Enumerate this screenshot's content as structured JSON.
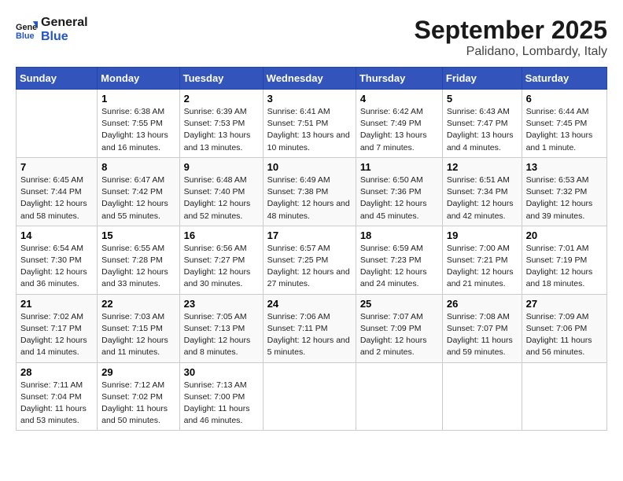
{
  "header": {
    "logo_line1": "General",
    "logo_line2": "Blue",
    "month": "September 2025",
    "location": "Palidano, Lombardy, Italy"
  },
  "weekdays": [
    "Sunday",
    "Monday",
    "Tuesday",
    "Wednesday",
    "Thursday",
    "Friday",
    "Saturday"
  ],
  "weeks": [
    [
      {
        "day": "",
        "sunrise": "",
        "sunset": "",
        "daylight": ""
      },
      {
        "day": "1",
        "sunrise": "Sunrise: 6:38 AM",
        "sunset": "Sunset: 7:55 PM",
        "daylight": "Daylight: 13 hours and 16 minutes."
      },
      {
        "day": "2",
        "sunrise": "Sunrise: 6:39 AM",
        "sunset": "Sunset: 7:53 PM",
        "daylight": "Daylight: 13 hours and 13 minutes."
      },
      {
        "day": "3",
        "sunrise": "Sunrise: 6:41 AM",
        "sunset": "Sunset: 7:51 PM",
        "daylight": "Daylight: 13 hours and 10 minutes."
      },
      {
        "day": "4",
        "sunrise": "Sunrise: 6:42 AM",
        "sunset": "Sunset: 7:49 PM",
        "daylight": "Daylight: 13 hours and 7 minutes."
      },
      {
        "day": "5",
        "sunrise": "Sunrise: 6:43 AM",
        "sunset": "Sunset: 7:47 PM",
        "daylight": "Daylight: 13 hours and 4 minutes."
      },
      {
        "day": "6",
        "sunrise": "Sunrise: 6:44 AM",
        "sunset": "Sunset: 7:45 PM",
        "daylight": "Daylight: 13 hours and 1 minute."
      }
    ],
    [
      {
        "day": "7",
        "sunrise": "Sunrise: 6:45 AM",
        "sunset": "Sunset: 7:44 PM",
        "daylight": "Daylight: 12 hours and 58 minutes."
      },
      {
        "day": "8",
        "sunrise": "Sunrise: 6:47 AM",
        "sunset": "Sunset: 7:42 PM",
        "daylight": "Daylight: 12 hours and 55 minutes."
      },
      {
        "day": "9",
        "sunrise": "Sunrise: 6:48 AM",
        "sunset": "Sunset: 7:40 PM",
        "daylight": "Daylight: 12 hours and 52 minutes."
      },
      {
        "day": "10",
        "sunrise": "Sunrise: 6:49 AM",
        "sunset": "Sunset: 7:38 PM",
        "daylight": "Daylight: 12 hours and 48 minutes."
      },
      {
        "day": "11",
        "sunrise": "Sunrise: 6:50 AM",
        "sunset": "Sunset: 7:36 PM",
        "daylight": "Daylight: 12 hours and 45 minutes."
      },
      {
        "day": "12",
        "sunrise": "Sunrise: 6:51 AM",
        "sunset": "Sunset: 7:34 PM",
        "daylight": "Daylight: 12 hours and 42 minutes."
      },
      {
        "day": "13",
        "sunrise": "Sunrise: 6:53 AM",
        "sunset": "Sunset: 7:32 PM",
        "daylight": "Daylight: 12 hours and 39 minutes."
      }
    ],
    [
      {
        "day": "14",
        "sunrise": "Sunrise: 6:54 AM",
        "sunset": "Sunset: 7:30 PM",
        "daylight": "Daylight: 12 hours and 36 minutes."
      },
      {
        "day": "15",
        "sunrise": "Sunrise: 6:55 AM",
        "sunset": "Sunset: 7:28 PM",
        "daylight": "Daylight: 12 hours and 33 minutes."
      },
      {
        "day": "16",
        "sunrise": "Sunrise: 6:56 AM",
        "sunset": "Sunset: 7:27 PM",
        "daylight": "Daylight: 12 hours and 30 minutes."
      },
      {
        "day": "17",
        "sunrise": "Sunrise: 6:57 AM",
        "sunset": "Sunset: 7:25 PM",
        "daylight": "Daylight: 12 hours and 27 minutes."
      },
      {
        "day": "18",
        "sunrise": "Sunrise: 6:59 AM",
        "sunset": "Sunset: 7:23 PM",
        "daylight": "Daylight: 12 hours and 24 minutes."
      },
      {
        "day": "19",
        "sunrise": "Sunrise: 7:00 AM",
        "sunset": "Sunset: 7:21 PM",
        "daylight": "Daylight: 12 hours and 21 minutes."
      },
      {
        "day": "20",
        "sunrise": "Sunrise: 7:01 AM",
        "sunset": "Sunset: 7:19 PM",
        "daylight": "Daylight: 12 hours and 18 minutes."
      }
    ],
    [
      {
        "day": "21",
        "sunrise": "Sunrise: 7:02 AM",
        "sunset": "Sunset: 7:17 PM",
        "daylight": "Daylight: 12 hours and 14 minutes."
      },
      {
        "day": "22",
        "sunrise": "Sunrise: 7:03 AM",
        "sunset": "Sunset: 7:15 PM",
        "daylight": "Daylight: 12 hours and 11 minutes."
      },
      {
        "day": "23",
        "sunrise": "Sunrise: 7:05 AM",
        "sunset": "Sunset: 7:13 PM",
        "daylight": "Daylight: 12 hours and 8 minutes."
      },
      {
        "day": "24",
        "sunrise": "Sunrise: 7:06 AM",
        "sunset": "Sunset: 7:11 PM",
        "daylight": "Daylight: 12 hours and 5 minutes."
      },
      {
        "day": "25",
        "sunrise": "Sunrise: 7:07 AM",
        "sunset": "Sunset: 7:09 PM",
        "daylight": "Daylight: 12 hours and 2 minutes."
      },
      {
        "day": "26",
        "sunrise": "Sunrise: 7:08 AM",
        "sunset": "Sunset: 7:07 PM",
        "daylight": "Daylight: 11 hours and 59 minutes."
      },
      {
        "day": "27",
        "sunrise": "Sunrise: 7:09 AM",
        "sunset": "Sunset: 7:06 PM",
        "daylight": "Daylight: 11 hours and 56 minutes."
      }
    ],
    [
      {
        "day": "28",
        "sunrise": "Sunrise: 7:11 AM",
        "sunset": "Sunset: 7:04 PM",
        "daylight": "Daylight: 11 hours and 53 minutes."
      },
      {
        "day": "29",
        "sunrise": "Sunrise: 7:12 AM",
        "sunset": "Sunset: 7:02 PM",
        "daylight": "Daylight: 11 hours and 50 minutes."
      },
      {
        "day": "30",
        "sunrise": "Sunrise: 7:13 AM",
        "sunset": "Sunset: 7:00 PM",
        "daylight": "Daylight: 11 hours and 46 minutes."
      },
      {
        "day": "",
        "sunrise": "",
        "sunset": "",
        "daylight": ""
      },
      {
        "day": "",
        "sunrise": "",
        "sunset": "",
        "daylight": ""
      },
      {
        "day": "",
        "sunrise": "",
        "sunset": "",
        "daylight": ""
      },
      {
        "day": "",
        "sunrise": "",
        "sunset": "",
        "daylight": ""
      }
    ]
  ]
}
